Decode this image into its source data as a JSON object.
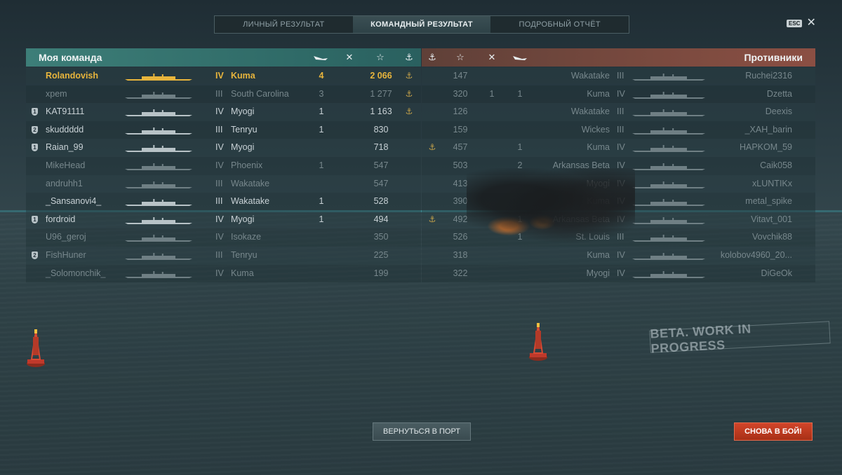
{
  "tabs": [
    {
      "label": "ЛИЧНЫЙ РЕЗУЛЬТАТ",
      "active": false
    },
    {
      "label": "КОМАНДНЫЙ РЕЗУЛЬТАТ",
      "active": true
    },
    {
      "label": "ПОДРОБНЫЙ ОТЧЁТ",
      "active": false
    }
  ],
  "esc_label": "ESC",
  "close_icon": "close-icon",
  "my_team": {
    "title": "Моя команда",
    "column_icons": [
      "torpedo-icon",
      "crossed-guns-icon",
      "star-icon",
      "anchor-icon"
    ],
    "rows": [
      {
        "player": "Rolandovish",
        "tier": "IV",
        "ship": "Kuma",
        "kills": "4",
        "xp": "2 066",
        "anchor": true,
        "badge": "",
        "state": "me"
      },
      {
        "player": "xpem",
        "tier": "III",
        "ship": "South Carolina",
        "kills": "3",
        "xp": "1 277",
        "anchor": true,
        "badge": "",
        "state": "dim"
      },
      {
        "player": "KAT91111",
        "tier": "IV",
        "ship": "Myogi",
        "kills": "1",
        "xp": "1 163",
        "anchor": true,
        "badge": "1",
        "state": "alive"
      },
      {
        "player": "skuddddd",
        "tier": "III",
        "ship": "Tenryu",
        "kills": "1",
        "xp": "830",
        "anchor": false,
        "badge": "2",
        "state": "alive"
      },
      {
        "player": "Raian_99",
        "tier": "IV",
        "ship": "Myogi",
        "kills": "",
        "xp": "718",
        "anchor": false,
        "badge": "1",
        "state": "alive"
      },
      {
        "player": "MikeHead",
        "tier": "IV",
        "ship": "Phoenix",
        "kills": "1",
        "xp": "547",
        "anchor": false,
        "badge": "",
        "state": "dim"
      },
      {
        "player": "andruhh1",
        "tier": "III",
        "ship": "Wakatake",
        "kills": "",
        "xp": "547",
        "anchor": false,
        "badge": "",
        "state": "dim"
      },
      {
        "player": "_Sansanovi4_",
        "tier": "III",
        "ship": "Wakatake",
        "kills": "1",
        "xp": "528",
        "anchor": false,
        "badge": "",
        "state": "alive"
      },
      {
        "player": "fordroid",
        "tier": "IV",
        "ship": "Myogi",
        "kills": "1",
        "xp": "494",
        "anchor": false,
        "badge": "1",
        "state": "alive"
      },
      {
        "player": "U96_geroj",
        "tier": "IV",
        "ship": "Isokaze",
        "kills": "",
        "xp": "350",
        "anchor": false,
        "badge": "",
        "state": "dim"
      },
      {
        "player": "FishHuner",
        "tier": "III",
        "ship": "Tenryu",
        "kills": "",
        "xp": "225",
        "anchor": false,
        "badge": "2",
        "state": "dim"
      },
      {
        "player": "_Solomonchik_",
        "tier": "IV",
        "ship": "Kuma",
        "kills": "",
        "xp": "199",
        "anchor": false,
        "badge": "",
        "state": "dim"
      }
    ]
  },
  "enemy_team": {
    "title": "Противники",
    "column_icons": [
      "anchor-icon",
      "star-icon",
      "crossed-guns-icon",
      "torpedo-icon"
    ],
    "rows": [
      {
        "anchor": false,
        "xp": "147",
        "damage": "",
        "kills": "",
        "ship": "Wakatake",
        "tier": "III",
        "player": "Ruchei2316",
        "state": "dim"
      },
      {
        "anchor": false,
        "xp": "320",
        "damage": "1",
        "kills": "1",
        "ship": "Kuma",
        "tier": "IV",
        "player": "Dzetta",
        "state": "dim"
      },
      {
        "anchor": false,
        "xp": "126",
        "damage": "",
        "kills": "",
        "ship": "Wakatake",
        "tier": "III",
        "player": "Deexis",
        "state": "dim"
      },
      {
        "anchor": false,
        "xp": "159",
        "damage": "",
        "kills": "",
        "ship": "Wickes",
        "tier": "III",
        "player": "_XAH_barin",
        "state": "dim"
      },
      {
        "anchor": true,
        "xp": "457",
        "damage": "",
        "kills": "1",
        "ship": "Kuma",
        "tier": "IV",
        "player": "HAPKOM_59",
        "state": "dim"
      },
      {
        "anchor": false,
        "xp": "503",
        "damage": "",
        "kills": "2",
        "ship": "Arkansas Beta",
        "tier": "IV",
        "player": "Caik058",
        "state": "dim"
      },
      {
        "anchor": false,
        "xp": "413",
        "damage": "",
        "kills": "",
        "ship": "Myogi",
        "tier": "IV",
        "player": "xLUNTIKx",
        "state": "dim"
      },
      {
        "anchor": false,
        "xp": "390",
        "damage": "",
        "kills": "",
        "ship": "Kuma",
        "tier": "IV",
        "player": "metal_spike",
        "state": "dim"
      },
      {
        "anchor": true,
        "xp": "492",
        "damage": "",
        "kills": "1",
        "ship": "Arkansas Beta",
        "tier": "IV",
        "player": "Vitavt_001",
        "state": "dim"
      },
      {
        "anchor": false,
        "xp": "526",
        "damage": "",
        "kills": "1",
        "ship": "St. Louis",
        "tier": "III",
        "player": "Vovchik88",
        "state": "dim"
      },
      {
        "anchor": false,
        "xp": "318",
        "damage": "",
        "kills": "",
        "ship": "Kuma",
        "tier": "IV",
        "player": "kolobov4960_20...",
        "state": "dim"
      },
      {
        "anchor": false,
        "xp": "322",
        "damage": "",
        "kills": "",
        "ship": "Myogi",
        "tier": "IV",
        "player": "DiGeOk",
        "state": "dim"
      }
    ]
  },
  "watermark": "BETA. WORK IN PROGRESS",
  "buttons": {
    "port": "ВЕРНУТЬСЯ В ПОРТ",
    "battle": "СНОВА В БОЙ!"
  },
  "colors": {
    "my_team_header": "#2f6a67",
    "enemy_header": "#7a4a3f",
    "highlight_player": "#e8b53c",
    "battle_button": "#c23b20"
  }
}
